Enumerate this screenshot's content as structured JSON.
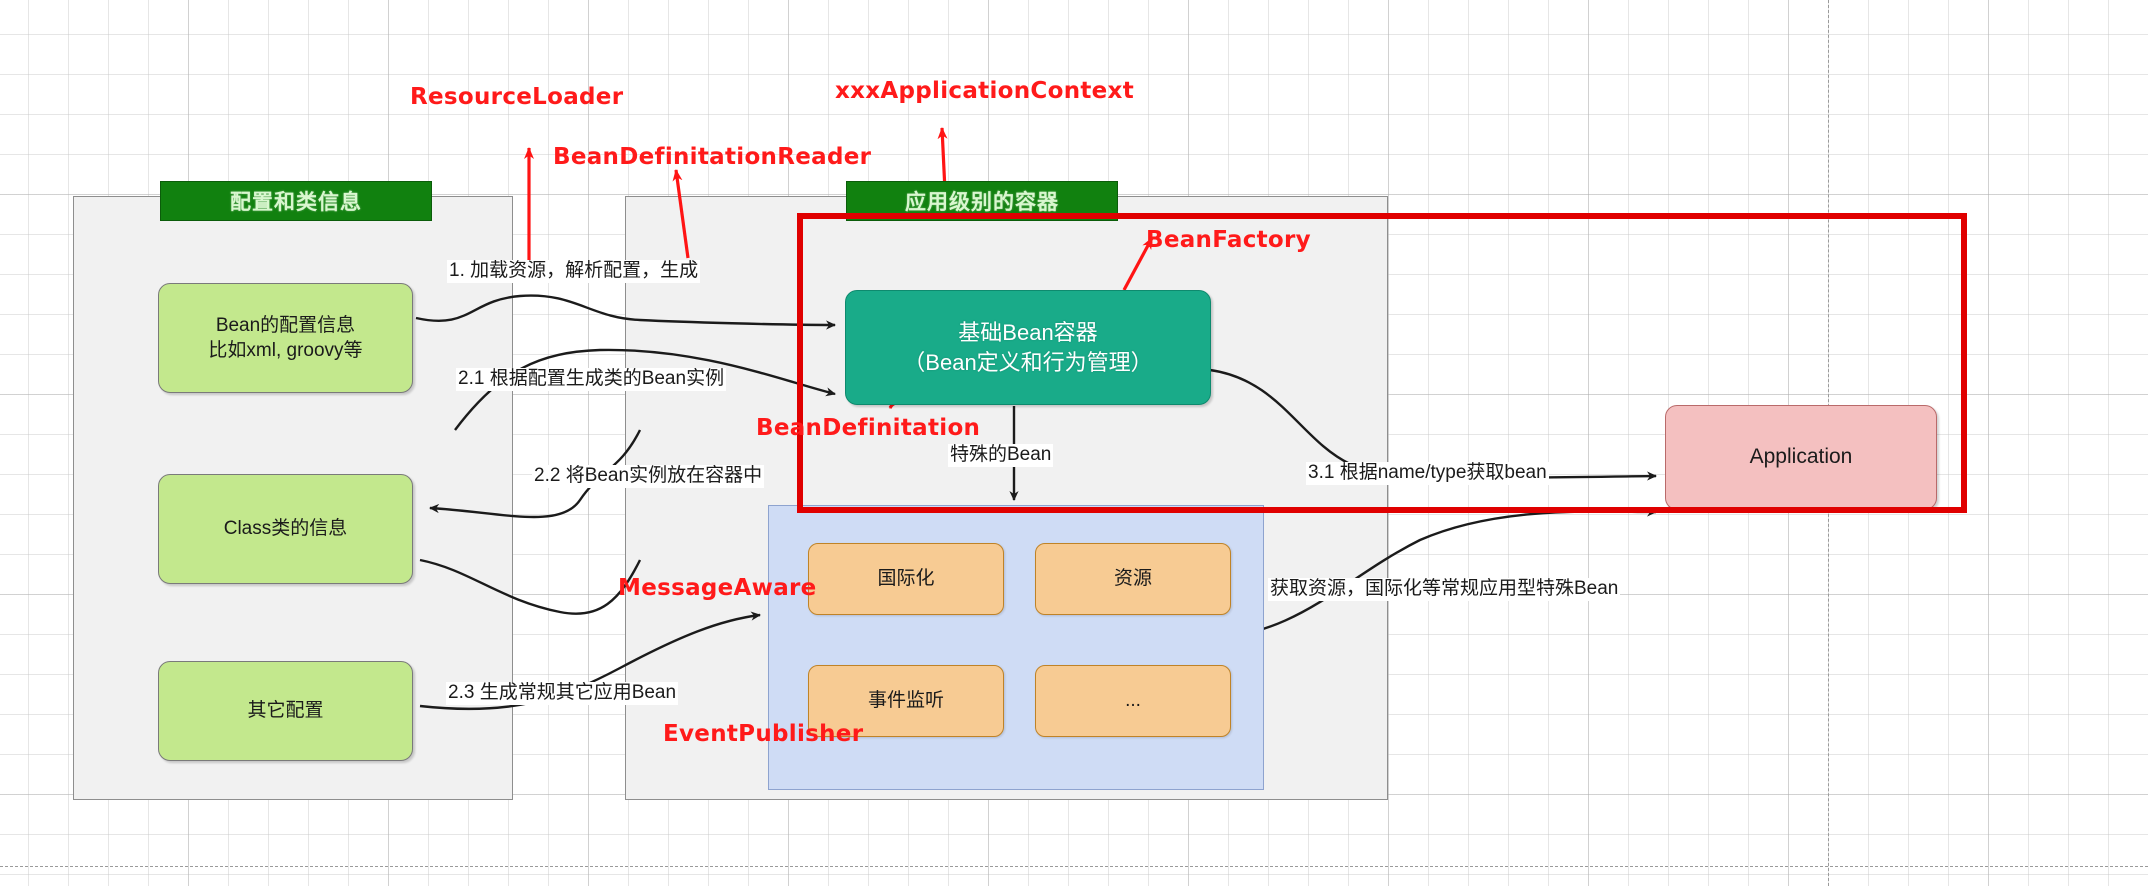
{
  "diagram": {
    "title": "Spring IoC container structure diagram",
    "colors": {
      "swimlane_title_bg": "#11810f",
      "green_node": "#c3e88d",
      "teal_node": "#19ab89",
      "orange_node": "#f7cb93",
      "red_node": "#f4c0c0",
      "blue_panel": "#cfdcf5",
      "annotation_red": "#ff1a1a",
      "highlight_border": "#e00000"
    }
  },
  "swimlanes": [
    {
      "id": "config",
      "title": "配置和类信息"
    },
    {
      "id": "appcontainer",
      "title": "应用级别的容器"
    }
  ],
  "nodes": {
    "bean_config": "Bean的配置信息\n比如xml, groovy等",
    "bean_config_line1": "Bean的配置信息",
    "bean_config_line2": "比如xml, groovy等",
    "class_info": "Class类的信息",
    "other_config": "其它配置",
    "bean_container_line1": "基础Bean容器",
    "bean_container_line2": "（Bean定义和行为管理）",
    "application": "Application",
    "i18n": "国际化",
    "resource": "资源",
    "event_listener": "事件监听",
    "ellipsis": "..."
  },
  "edge_labels": {
    "step1": "1. 加载资源，解析配置，生成",
    "step21": "2.1  根据配置生成类的Bean实例",
    "step22": "2.2 将Bean实例放在容器中",
    "step23": "2.3 生成常规其它应用Bean",
    "special_bean": "特殊的Bean",
    "step31": "3.1 根据name/type获取bean",
    "get_resource": "获取资源，国际化等常规应用型特殊Bean"
  },
  "annotations": {
    "resource_loader": "ResourceLoader",
    "bean_definition_reader": "BeanDefinitationReader",
    "xxx_application_context": "xxxApplicationContext",
    "bean_factory": "BeanFactory",
    "bean_definitation": "BeanDefinitation",
    "message_aware": "MessageAware",
    "event_publisher": "EventPublisher"
  }
}
